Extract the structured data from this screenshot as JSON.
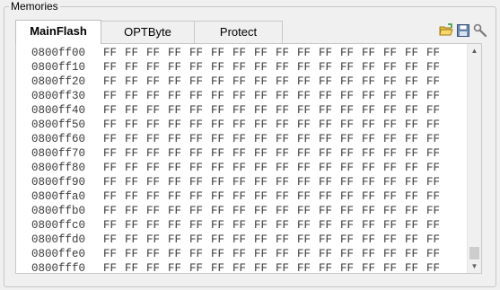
{
  "group": {
    "title": "Memories"
  },
  "tabs": [
    {
      "label": "MainFlash",
      "active": true
    },
    {
      "label": "OPTByte",
      "active": false
    },
    {
      "label": "Protect",
      "active": false
    }
  ],
  "toolbar": {
    "icons": [
      "open-folder-icon",
      "save-disk-icon",
      "settings-wrench-icon"
    ]
  },
  "memory": {
    "rows": [
      {
        "address": "0800ff00",
        "bytes": [
          "FF",
          "FF",
          "FF",
          "FF",
          "FF",
          "FF",
          "FF",
          "FF",
          "FF",
          "FF",
          "FF",
          "FF",
          "FF",
          "FF",
          "FF",
          "FF"
        ]
      },
      {
        "address": "0800ff10",
        "bytes": [
          "FF",
          "FF",
          "FF",
          "FF",
          "FF",
          "FF",
          "FF",
          "FF",
          "FF",
          "FF",
          "FF",
          "FF",
          "FF",
          "FF",
          "FF",
          "FF"
        ]
      },
      {
        "address": "0800ff20",
        "bytes": [
          "FF",
          "FF",
          "FF",
          "FF",
          "FF",
          "FF",
          "FF",
          "FF",
          "FF",
          "FF",
          "FF",
          "FF",
          "FF",
          "FF",
          "FF",
          "FF"
        ]
      },
      {
        "address": "0800ff30",
        "bytes": [
          "FF",
          "FF",
          "FF",
          "FF",
          "FF",
          "FF",
          "FF",
          "FF",
          "FF",
          "FF",
          "FF",
          "FF",
          "FF",
          "FF",
          "FF",
          "FF"
        ]
      },
      {
        "address": "0800ff40",
        "bytes": [
          "FF",
          "FF",
          "FF",
          "FF",
          "FF",
          "FF",
          "FF",
          "FF",
          "FF",
          "FF",
          "FF",
          "FF",
          "FF",
          "FF",
          "FF",
          "FF"
        ]
      },
      {
        "address": "0800ff50",
        "bytes": [
          "FF",
          "FF",
          "FF",
          "FF",
          "FF",
          "FF",
          "FF",
          "FF",
          "FF",
          "FF",
          "FF",
          "FF",
          "FF",
          "FF",
          "FF",
          "FF"
        ]
      },
      {
        "address": "0800ff60",
        "bytes": [
          "FF",
          "FF",
          "FF",
          "FF",
          "FF",
          "FF",
          "FF",
          "FF",
          "FF",
          "FF",
          "FF",
          "FF",
          "FF",
          "FF",
          "FF",
          "FF"
        ]
      },
      {
        "address": "0800ff70",
        "bytes": [
          "FF",
          "FF",
          "FF",
          "FF",
          "FF",
          "FF",
          "FF",
          "FF",
          "FF",
          "FF",
          "FF",
          "FF",
          "FF",
          "FF",
          "FF",
          "FF"
        ]
      },
      {
        "address": "0800ff80",
        "bytes": [
          "FF",
          "FF",
          "FF",
          "FF",
          "FF",
          "FF",
          "FF",
          "FF",
          "FF",
          "FF",
          "FF",
          "FF",
          "FF",
          "FF",
          "FF",
          "FF"
        ]
      },
      {
        "address": "0800ff90",
        "bytes": [
          "FF",
          "FF",
          "FF",
          "FF",
          "FF",
          "FF",
          "FF",
          "FF",
          "FF",
          "FF",
          "FF",
          "FF",
          "FF",
          "FF",
          "FF",
          "FF"
        ]
      },
      {
        "address": "0800ffa0",
        "bytes": [
          "FF",
          "FF",
          "FF",
          "FF",
          "FF",
          "FF",
          "FF",
          "FF",
          "FF",
          "FF",
          "FF",
          "FF",
          "FF",
          "FF",
          "FF",
          "FF"
        ]
      },
      {
        "address": "0800ffb0",
        "bytes": [
          "FF",
          "FF",
          "FF",
          "FF",
          "FF",
          "FF",
          "FF",
          "FF",
          "FF",
          "FF",
          "FF",
          "FF",
          "FF",
          "FF",
          "FF",
          "FF"
        ]
      },
      {
        "address": "0800ffc0",
        "bytes": [
          "FF",
          "FF",
          "FF",
          "FF",
          "FF",
          "FF",
          "FF",
          "FF",
          "FF",
          "FF",
          "FF",
          "FF",
          "FF",
          "FF",
          "FF",
          "FF"
        ]
      },
      {
        "address": "0800ffd0",
        "bytes": [
          "FF",
          "FF",
          "FF",
          "FF",
          "FF",
          "FF",
          "FF",
          "FF",
          "FF",
          "FF",
          "FF",
          "FF",
          "FF",
          "FF",
          "FF",
          "FF"
        ]
      },
      {
        "address": "0800ffe0",
        "bytes": [
          "FF",
          "FF",
          "FF",
          "FF",
          "FF",
          "FF",
          "FF",
          "FF",
          "FF",
          "FF",
          "FF",
          "FF",
          "FF",
          "FF",
          "FF",
          "FF"
        ]
      },
      {
        "address": "0800fff0",
        "bytes": [
          "FF",
          "FF",
          "FF",
          "FF",
          "FF",
          "FF",
          "FF",
          "FF",
          "FF",
          "FF",
          "FF",
          "FF",
          "FF",
          "FF",
          "FF",
          "FF"
        ]
      }
    ]
  },
  "colors": {
    "background": "#f0f0f0",
    "panel": "#ffffff",
    "border": "#c8c8c8",
    "text": "#3a3a3a"
  }
}
